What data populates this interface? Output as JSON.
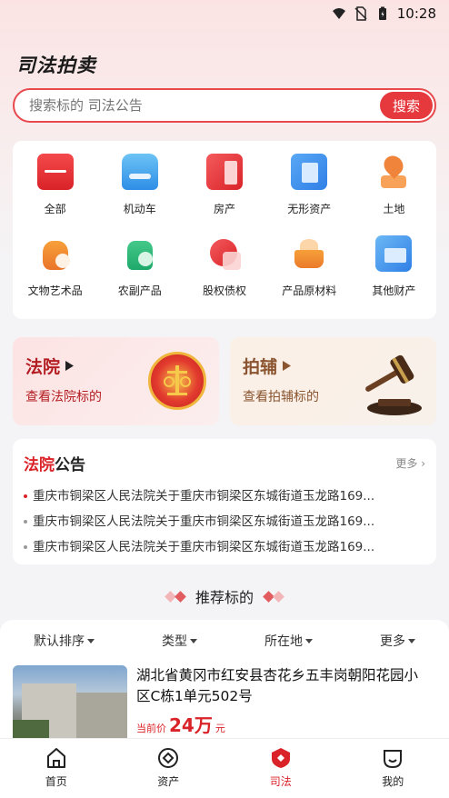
{
  "status_bar": {
    "time": "10:28"
  },
  "app_title": "司法拍卖",
  "search": {
    "placeholder": "搜索标的 司法公告",
    "button_label": "搜索"
  },
  "categories": [
    {
      "label": "全部",
      "icon": "all-icon"
    },
    {
      "label": "机动车",
      "icon": "vehicle-icon"
    },
    {
      "label": "房产",
      "icon": "property-icon"
    },
    {
      "label": "无形资产",
      "icon": "intangible-asset-icon"
    },
    {
      "label": "土地",
      "icon": "land-icon"
    },
    {
      "label": "文物艺术品",
      "icon": "artwork-icon"
    },
    {
      "label": "农副产品",
      "icon": "farm-product-icon"
    },
    {
      "label": "股权债权",
      "icon": "equity-icon"
    },
    {
      "label": "产品原材料",
      "icon": "raw-material-icon"
    },
    {
      "label": "其他财产",
      "icon": "other-property-icon"
    }
  ],
  "promo": {
    "court": {
      "title": "法院",
      "subtitle": "查看法院标的"
    },
    "aux": {
      "title": "拍辅",
      "subtitle": "查看拍辅标的"
    }
  },
  "notice": {
    "title_red": "法院",
    "title_black": "公告",
    "more": "更多",
    "items": [
      "重庆市铜梁区人民法院关于重庆市铜梁区东城街道玉龙路169...",
      "重庆市铜梁区人民法院关于重庆市铜梁区东城街道玉龙路169...",
      "重庆市铜梁区人民法院关于重庆市铜梁区东城街道玉龙路169..."
    ]
  },
  "recommend_title": "推荐标的",
  "filters": [
    "默认排序",
    "类型",
    "所在地",
    "更多"
  ],
  "listing": {
    "title": "湖北省黄冈市红安县杏花乡五丰岗朝阳花园小区C栋1单元502号",
    "price_label": "当前价",
    "price": "24万",
    "price_unit": "元"
  },
  "tabs": [
    {
      "label": "首页",
      "icon": "home-icon"
    },
    {
      "label": "资产",
      "icon": "asset-icon"
    },
    {
      "label": "司法",
      "icon": "justice-icon",
      "active": true
    },
    {
      "label": "我的",
      "icon": "profile-icon"
    }
  ],
  "colors": {
    "accent": "#e5393e",
    "court_red": "#b31e23",
    "aux_brown": "#8a5530"
  }
}
